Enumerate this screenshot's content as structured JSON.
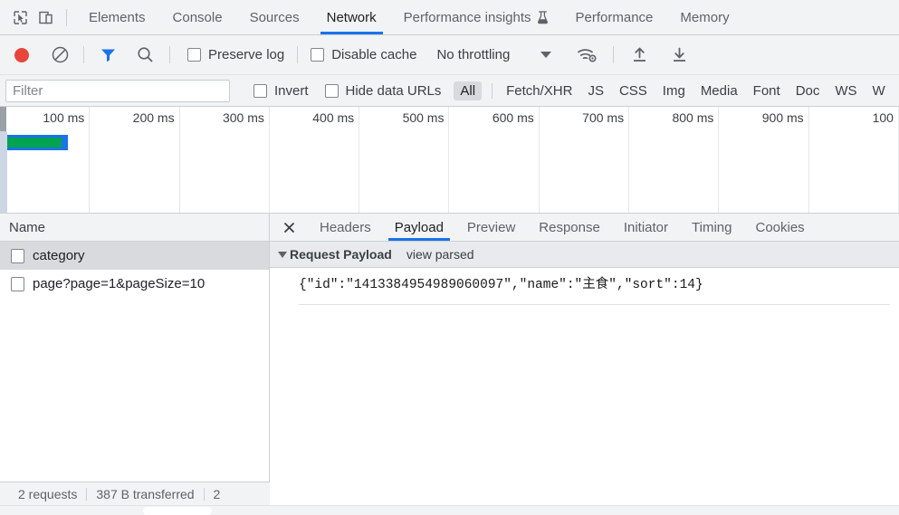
{
  "panel_tabs": {
    "inspect_icon": "inspect-cursor-icon",
    "device_toolbar_icon": "device-toolbar-icon",
    "items": [
      {
        "label": "Elements",
        "selected": false,
        "experimental": false
      },
      {
        "label": "Console",
        "selected": false,
        "experimental": false
      },
      {
        "label": "Sources",
        "selected": false,
        "experimental": false
      },
      {
        "label": "Network",
        "selected": true,
        "experimental": false
      },
      {
        "label": "Performance insights",
        "selected": false,
        "experimental": true
      },
      {
        "label": "Performance",
        "selected": false,
        "experimental": false
      },
      {
        "label": "Memory",
        "selected": false,
        "experimental": false
      }
    ]
  },
  "network_toolbar": {
    "record_icon": "record-button-icon",
    "clear_icon": "clear-icon",
    "filter_icon": "filter-icon",
    "search_icon": "search-icon",
    "preserve_log": {
      "label": "Preserve log",
      "checked": false
    },
    "disable_cache": {
      "label": "Disable cache",
      "checked": false
    },
    "throttling": {
      "value": "No throttling",
      "caret_icon": "chevron-down-icon"
    },
    "network_conditions_icon": "wifi-settings-icon",
    "import_har_icon": "import-har-icon",
    "export_har_icon": "export-har-icon"
  },
  "filter_bar": {
    "filter_placeholder": "Filter",
    "filter_value": "",
    "invert": {
      "label": "Invert",
      "checked": false
    },
    "hide_data_urls": {
      "label": "Hide data URLs",
      "checked": false
    },
    "types": [
      {
        "label": "All",
        "selected": true
      },
      {
        "label": "Fetch/XHR",
        "selected": false
      },
      {
        "label": "JS",
        "selected": false
      },
      {
        "label": "CSS",
        "selected": false
      },
      {
        "label": "Img",
        "selected": false
      },
      {
        "label": "Media",
        "selected": false
      },
      {
        "label": "Font",
        "selected": false
      },
      {
        "label": "Doc",
        "selected": false
      },
      {
        "label": "WS",
        "selected": false
      },
      {
        "label": "W",
        "selected": false
      }
    ]
  },
  "overview": {
    "ticks": [
      "100 ms",
      "200 ms",
      "300 ms",
      "400 ms",
      "500 ms",
      "600 ms",
      "700 ms",
      "800 ms",
      "900 ms",
      "100"
    ],
    "bar_color_outer": "#1a73e8",
    "bar_color_inner": "#00a350"
  },
  "request_list": {
    "column_header": "Name",
    "rows": [
      {
        "name": "category",
        "selected": true,
        "icon": "resource-file-icon"
      },
      {
        "name": "page?page=1&pageSize=10",
        "selected": false,
        "icon": "resource-file-icon"
      }
    ]
  },
  "detail_panel": {
    "close_icon": "close-icon",
    "tabs": [
      {
        "label": "Headers",
        "selected": false
      },
      {
        "label": "Payload",
        "selected": true
      },
      {
        "label": "Preview",
        "selected": false
      },
      {
        "label": "Response",
        "selected": false
      },
      {
        "label": "Initiator",
        "selected": false
      },
      {
        "label": "Timing",
        "selected": false
      },
      {
        "label": "Cookies",
        "selected": false
      }
    ],
    "payload": {
      "section_title": "Request Payload",
      "view_parsed_label": "view parsed",
      "disclosure_icon": "triangle-down-icon",
      "json_text": "{\"id\":\"1413384954989060097\",\"name\":\"主食\",\"sort\":14}"
    }
  },
  "status_bar": {
    "requests": "2 requests",
    "transferred": "387 B transferred",
    "resources_truncated": "2"
  }
}
